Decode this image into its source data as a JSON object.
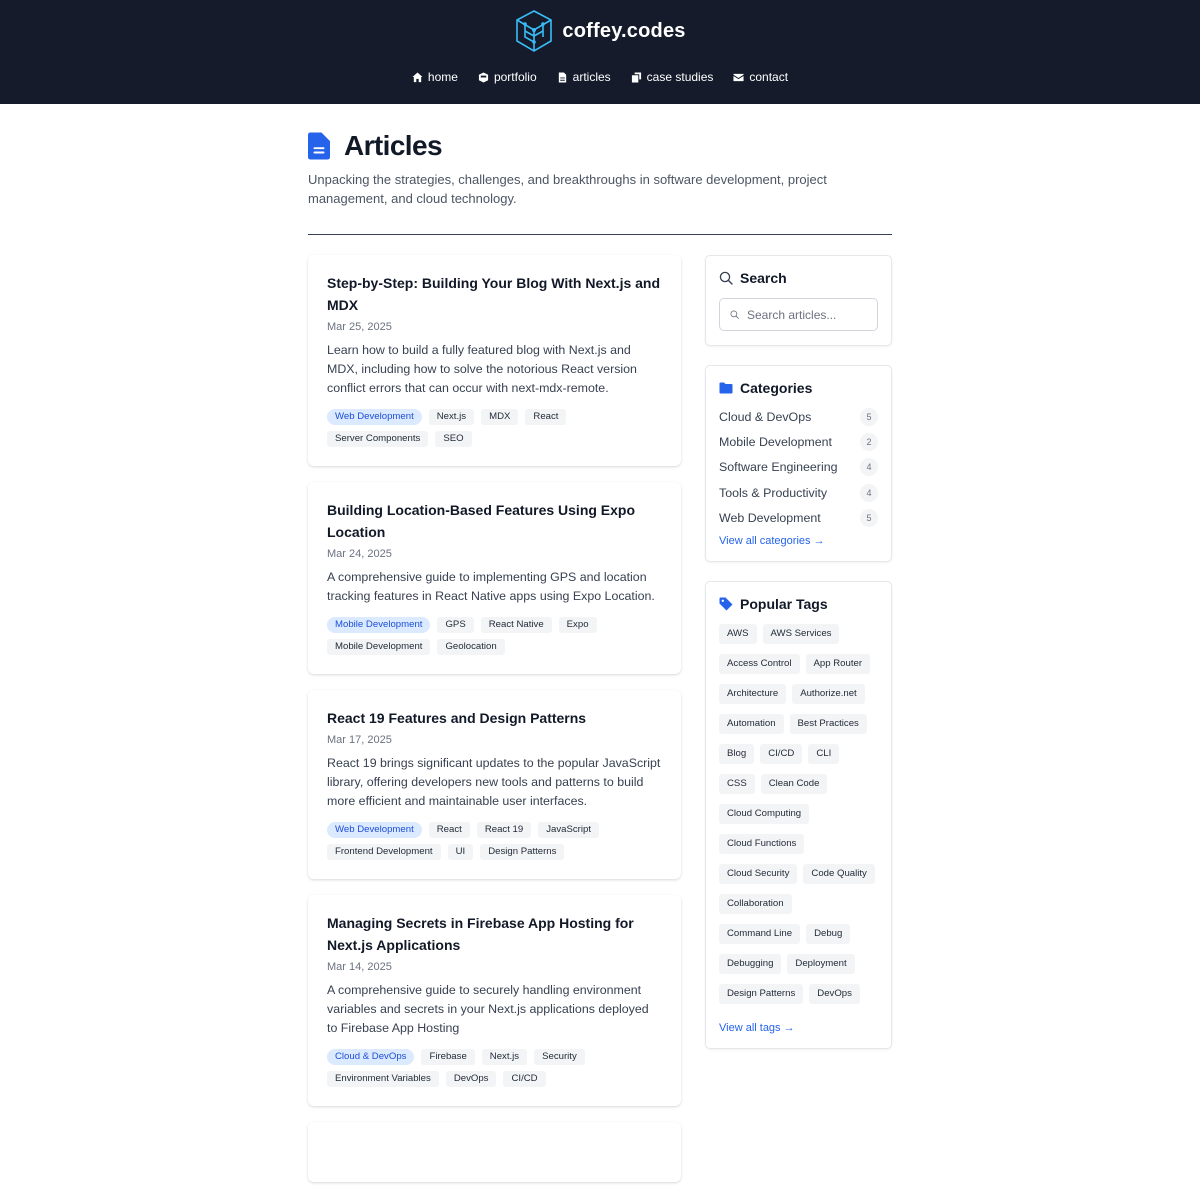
{
  "header": {
    "brand": "coffey.codes",
    "nav": [
      {
        "label": "home",
        "icon": "home-icon"
      },
      {
        "label": "portfolio",
        "icon": "portfolio-icon"
      },
      {
        "label": "articles",
        "icon": "document-icon"
      },
      {
        "label": "case studies",
        "icon": "case-studies-icon"
      },
      {
        "label": "contact",
        "icon": "envelope-icon"
      }
    ]
  },
  "page": {
    "title": "Articles",
    "description": "Unpacking the strategies, challenges, and breakthroughs in software development, project management, and cloud technology."
  },
  "articles": [
    {
      "title": "Step-by-Step: Building Your Blog With Next.js and MDX",
      "date": "Mar 25, 2025",
      "excerpt": "Learn how to build a fully featured blog with Next.js and MDX, including how to solve the notorious React version conflict errors that can occur with next-mdx-remote.",
      "category": "Web Development",
      "tags": [
        "Next.js",
        "MDX",
        "React",
        "Server Components",
        "SEO"
      ]
    },
    {
      "title": "Building Location-Based Features Using Expo Location",
      "date": "Mar 24, 2025",
      "excerpt": "A comprehensive guide to implementing GPS and location tracking features in React Native apps using Expo Location.",
      "category": "Mobile Development",
      "tags": [
        "GPS",
        "React Native",
        "Expo",
        "Mobile Development",
        "Geolocation"
      ]
    },
    {
      "title": "React 19 Features and Design Patterns",
      "date": "Mar 17, 2025",
      "excerpt": "React 19 brings significant updates to the popular JavaScript library, offering developers new tools and patterns to build more efficient and maintainable user interfaces.",
      "category": "Web Development",
      "tags": [
        "React",
        "React 19",
        "JavaScript",
        "Frontend Development",
        "UI",
        "Design Patterns"
      ]
    },
    {
      "title": "Managing Secrets in Firebase App Hosting for Next.js Applications",
      "date": "Mar 14, 2025",
      "excerpt": "A comprehensive guide to securely handling environment variables and secrets in your Next.js applications deployed to Firebase App Hosting",
      "category": "Cloud & DevOps",
      "tags": [
        "Firebase",
        "Next.js",
        "Security",
        "Environment Variables",
        "DevOps",
        "CI/CD"
      ]
    }
  ],
  "sidebar": {
    "search": {
      "title": "Search",
      "placeholder": "Search articles..."
    },
    "categories": {
      "title": "Categories",
      "items": [
        {
          "name": "Cloud & DevOps",
          "count": "5"
        },
        {
          "name": "Mobile Development",
          "count": "2"
        },
        {
          "name": "Software Engineering",
          "count": "4"
        },
        {
          "name": "Tools & Productivity",
          "count": "4"
        },
        {
          "name": "Web Development",
          "count": "5"
        }
      ],
      "view_all": "View all categories →"
    },
    "tags": {
      "title": "Popular Tags",
      "items": [
        "AWS",
        "AWS Services",
        "Access Control",
        "App Router",
        "Architecture",
        "Authorize.net",
        "Automation",
        "Best Practices",
        "Blog",
        "CI/CD",
        "CLI",
        "CSS",
        "Clean Code",
        "Cloud Computing",
        "Cloud Functions",
        "Cloud Security",
        "Code Quality",
        "Collaboration",
        "Command Line",
        "Debug",
        "Debugging",
        "Deployment",
        "Design Patterns",
        "DevOps"
      ],
      "view_all": "View all tags →"
    }
  },
  "colors": {
    "header_bg": "#151b2b",
    "accent": "#2563eb",
    "logo": "#38bdf8",
    "category_tag_bg": "#dbeafe"
  }
}
